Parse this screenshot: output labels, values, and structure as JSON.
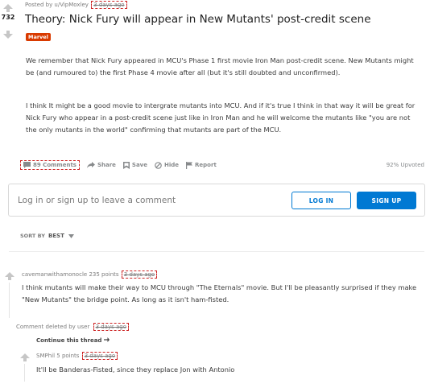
{
  "post": {
    "votes": "732",
    "posted_by": "Posted by u/VipMoxley",
    "time": "3 days ago",
    "title": "Theory: Nick Fury will appear in New Mutants' post-credit scene",
    "flair": "Marvel",
    "paragraphs": [
      "We remember that Nick Fury appeared in MCU's Phase 1 first movie Iron Man post-credit scene. New Mutants might be (and rumoured to) the first Phase 4 movie after all (but it's still doubted and unconfirmed).",
      "I think It might be a good movie to intergrate mutants into MCU. And if it's true I think in that way it will be great for Nick Fury who appear in a post-credit scene just like in Iron Man and he will welcome the mutants like \"you are not the only mutants in the world\" confirming that mutants are part of the MCU."
    ],
    "actions": {
      "comments": "89 Comments",
      "share": "Share",
      "save": "Save",
      "hide": "Hide",
      "report": "Report"
    },
    "upvoted": "92% Upvoted"
  },
  "login_prompt": {
    "text": "Log in or sign up to leave a comment",
    "login_label": "LOG IN",
    "signup_label": "SIGN UP"
  },
  "sort": {
    "label": "SORT BY",
    "value": "BEST"
  },
  "comments": [
    {
      "author": "cavemanwithamonocle",
      "points": "235 points",
      "time": "3 days ago",
      "text": "I think mutants will make their way to MCU through \"The Eternals\" movie. But I'll be pleasantly surprised if they make \"New Mutants\" the bridge point. As long as it isn't ham-fisted."
    },
    {
      "deleted_label": "Comment deleted by user",
      "time": "3 days ago",
      "continue_label": "Continue this thread"
    },
    {
      "author": "SMPhil",
      "points": "5 points",
      "time": "3 days ago",
      "text": "It'll be Banderas-Fisted, since they replace Jon with Antonio"
    }
  ],
  "colors": {
    "accent": "#0079d3",
    "flair": "#d93a00",
    "highlight_box": "#cc2222"
  }
}
